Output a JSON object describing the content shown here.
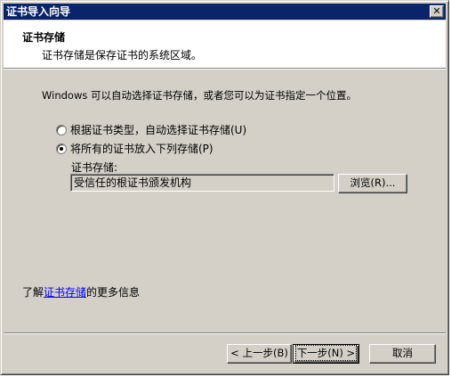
{
  "window": {
    "title": "证书导入向导",
    "close_glyph": "✕"
  },
  "header": {
    "title": "证书存储",
    "subtitle": "证书存储是保存证书的系统区域。"
  },
  "body": {
    "intro": "Windows 可以自动选择证书存储，或者您可以为证书指定一个位置。",
    "options": [
      {
        "label": "根据证书类型，自动选择证书存储(U)",
        "selected": false
      },
      {
        "label": "将所有的证书放入下列存储(P)",
        "selected": true
      }
    ],
    "store_label": "证书存储:",
    "store_value": "受信任的根证书颁发机构",
    "browse_label": "浏览(R)..."
  },
  "learn_more": {
    "prefix": "了解",
    "link": "证书存储",
    "suffix": "的更多信息"
  },
  "footer": {
    "back_label": "< 上一步(B)",
    "next_label": "下一步(N) >",
    "cancel_label": "取消"
  },
  "colors": {
    "titlebar": "#0a246a",
    "dialog_bg": "#d4d0c8",
    "link": "#0000ff"
  }
}
